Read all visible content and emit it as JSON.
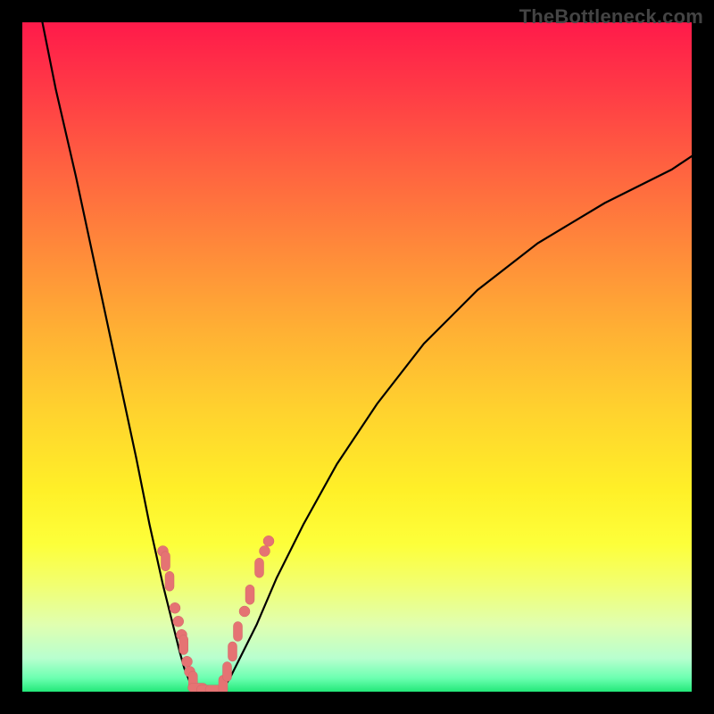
{
  "watermark": "TheBottleneck.com",
  "colors": {
    "frame": "#000000",
    "curve": "#000000",
    "marker_fill": "#e57373",
    "marker_stroke": "#d06868",
    "gradient_top": "#ff1a4a",
    "gradient_bottom": "#23e879"
  },
  "chart_data": {
    "type": "line",
    "title": "",
    "xlabel": "",
    "ylabel": "",
    "xlim": [
      0,
      100
    ],
    "ylim": [
      0,
      100
    ],
    "grid": false,
    "legend": false,
    "note": "No numeric axis ticks or data labels are rendered in the image; values below are positional estimates (0–100) read from the two black curves meeting at the bottom and from the salmon marker dots near the trough.",
    "series": [
      {
        "name": "left-curve",
        "x": [
          3,
          5,
          8,
          11,
          14,
          17,
          19,
          21,
          22.5,
          23.5,
          24.2,
          24.8,
          25.2,
          25.6,
          26.0,
          26.5
        ],
        "y": [
          100,
          90,
          77,
          63,
          49,
          35,
          25,
          16,
          10,
          6,
          3.5,
          2,
          1.0,
          0.5,
          0.2,
          0
        ]
      },
      {
        "name": "right-curve",
        "x": [
          29.5,
          30,
          31,
          32.5,
          35,
          38,
          42,
          47,
          53,
          60,
          68,
          77,
          87,
          97,
          100
        ],
        "y": [
          0,
          0.5,
          2,
          5,
          10,
          17,
          25,
          34,
          43,
          52,
          60,
          67,
          73,
          78,
          80
        ]
      }
    ],
    "markers": [
      {
        "x": 21.0,
        "y": 21.0,
        "shape": "circle"
      },
      {
        "x": 21.4,
        "y": 19.5,
        "shape": "pill-v"
      },
      {
        "x": 22.0,
        "y": 16.5,
        "shape": "pill-v"
      },
      {
        "x": 22.8,
        "y": 12.5,
        "shape": "circle"
      },
      {
        "x": 23.3,
        "y": 10.5,
        "shape": "circle"
      },
      {
        "x": 23.8,
        "y": 8.5,
        "shape": "circle"
      },
      {
        "x": 24.1,
        "y": 7.0,
        "shape": "pill-v"
      },
      {
        "x": 24.6,
        "y": 4.5,
        "shape": "circle"
      },
      {
        "x": 25.0,
        "y": 3.0,
        "shape": "circle"
      },
      {
        "x": 25.5,
        "y": 1.6,
        "shape": "pill-v"
      },
      {
        "x": 26.2,
        "y": 0.6,
        "shape": "pill-h"
      },
      {
        "x": 27.5,
        "y": 0.3,
        "shape": "pill-h"
      },
      {
        "x": 28.8,
        "y": 0.3,
        "shape": "pill-h"
      },
      {
        "x": 30.0,
        "y": 1.0,
        "shape": "pill-v"
      },
      {
        "x": 30.6,
        "y": 3.0,
        "shape": "pill-v"
      },
      {
        "x": 31.4,
        "y": 6.0,
        "shape": "pill-v"
      },
      {
        "x": 32.2,
        "y": 9.0,
        "shape": "pill-v"
      },
      {
        "x": 33.2,
        "y": 12.0,
        "shape": "circle"
      },
      {
        "x": 34.0,
        "y": 14.5,
        "shape": "pill-v"
      },
      {
        "x": 35.4,
        "y": 18.5,
        "shape": "pill-v"
      },
      {
        "x": 36.2,
        "y": 21.0,
        "shape": "circle"
      },
      {
        "x": 36.8,
        "y": 22.5,
        "shape": "circle"
      }
    ]
  }
}
